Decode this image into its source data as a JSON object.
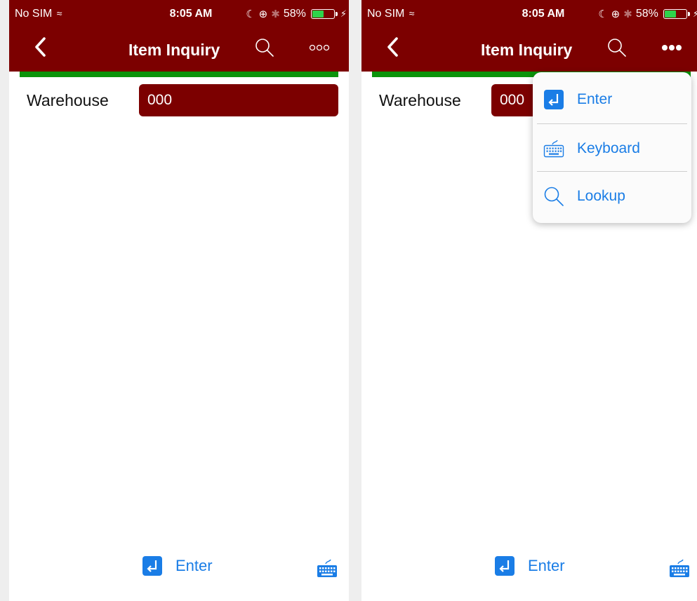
{
  "status_bar": {
    "carrier": "No SIM",
    "time": "8:05 AM",
    "battery_percent_text": "58%",
    "battery_level": 0.58
  },
  "nav": {
    "title": "Item Inquiry",
    "back_icon": "chevron-left-icon",
    "search_icon": "search-icon",
    "more_icon": "more-dots-icon"
  },
  "form": {
    "warehouse_label": "Warehouse",
    "warehouse_value": "000"
  },
  "bottom_bar": {
    "enter_label": "Enter",
    "keyboard_icon": "keyboard-icon"
  },
  "menu": {
    "items": [
      {
        "label": "Enter",
        "icon": "enter-icon"
      },
      {
        "label": "Keyboard",
        "icon": "keyboard-icon"
      },
      {
        "label": "Lookup",
        "icon": "search-icon"
      }
    ]
  },
  "colors": {
    "header_bg": "#7c0000",
    "accent_line": "#0b930b",
    "link_blue": "#1a7de6",
    "battery_green": "#2ed34a"
  }
}
